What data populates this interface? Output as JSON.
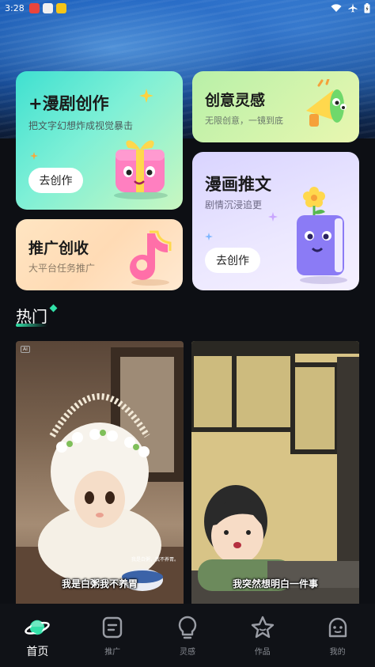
{
  "status_bar": {
    "time": "3:28"
  },
  "cards": {
    "comic": {
      "title": "+漫剧创作",
      "subtitle": "把文字幻想炸成视觉暴击",
      "button": "去创作"
    },
    "idea": {
      "title": "创意灵感",
      "subtitle": "无限创意，一镜到底"
    },
    "manga": {
      "title": "漫画推文",
      "subtitle": "剧情沉浸追更",
      "button": "去创作"
    },
    "promo": {
      "title": "推广创收",
      "subtitle": "大平台任务推广"
    }
  },
  "section": {
    "title": "热门"
  },
  "feed": [
    {
      "caption": "我是白粥我不养胃",
      "small_caption": "我是白粥，我不养胃。",
      "tag": "AI"
    },
    {
      "caption": "我突然想明白一件事"
    }
  ],
  "tabs": [
    {
      "label": "首页",
      "icon": "planet-icon",
      "active": true
    },
    {
      "label": "推广",
      "icon": "document-icon"
    },
    {
      "label": "灵感",
      "icon": "lightbulb-icon"
    },
    {
      "label": "作品",
      "icon": "star-icon"
    },
    {
      "label": "我的",
      "icon": "face-icon"
    }
  ],
  "colors": {
    "accent": "#32e0a8",
    "background": "#0d0f14"
  }
}
